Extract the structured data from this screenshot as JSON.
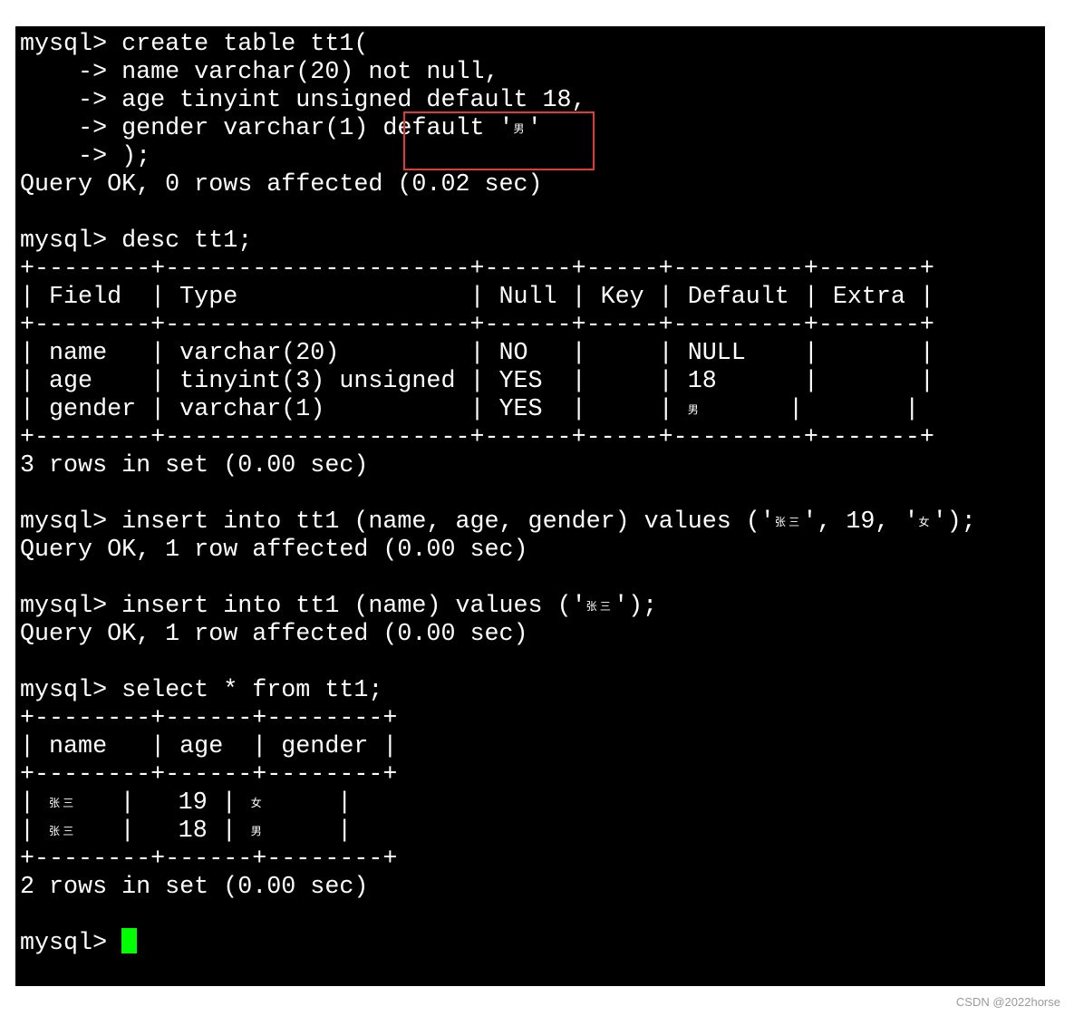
{
  "terminal": {
    "lines": [
      "mysql> create table tt1(",
      "    -> name varchar(20) not null,",
      "    -> age tinyint unsigned default 18,",
      "    -> gender varchar(1) default '男'",
      "    -> );",
      "Query OK, 0 rows affected (0.02 sec)",
      "",
      "mysql> desc tt1;",
      "+--------+---------------------+------+-----+---------+-------+",
      "| Field  | Type                | Null | Key | Default | Extra |",
      "+--------+---------------------+------+-----+---------+-------+",
      "| name   | varchar(20)         | NO   |     | NULL    |       |",
      "| age    | tinyint(3) unsigned | YES  |     | 18      |       |",
      "| gender | varchar(1)          | YES  |     | 男      |       |",
      "+--------+---------------------+------+-----+---------+-------+",
      "3 rows in set (0.00 sec)",
      "",
      "mysql> insert into tt1 (name, age, gender) values ('张三', 19, '女');",
      "Query OK, 1 row affected (0.00 sec)",
      "",
      "mysql> insert into tt1 (name) values ('张三');",
      "Query OK, 1 row affected (0.00 sec)",
      "",
      "mysql> select * from tt1;",
      "+--------+------+--------+",
      "| name   | age  | gender |",
      "+--------+------+--------+",
      "| 张三   |   19 | 女     |",
      "| 张三   |   18 | 男     |",
      "+--------+------+--------+",
      "2 rows in set (0.00 sec)",
      "",
      "mysql> "
    ],
    "cursor_color": "#00ff00",
    "highlight_color": "#e03a3a"
  },
  "watermark": "CSDN @2022horse"
}
